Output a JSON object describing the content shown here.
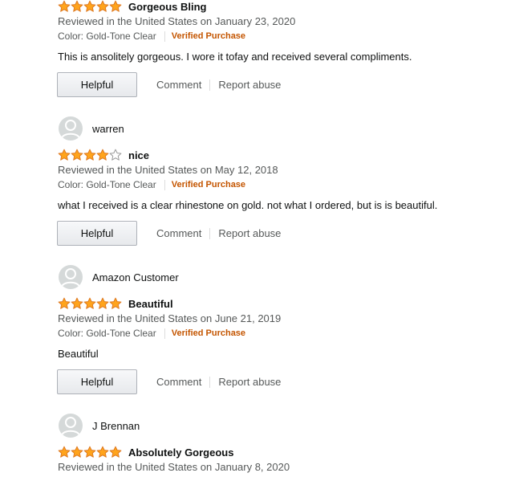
{
  "colors": {
    "star_fill": "#ffa41c",
    "star_stroke": "#de7921",
    "verified": "#c45500"
  },
  "reviews": [
    {
      "name": "",
      "rating": 5,
      "title": "Gorgeous Bling",
      "date": "Reviewed in the United States on January 23, 2020",
      "color": "Color: Gold-Tone Clear",
      "verified": "Verified Purchase",
      "body": "This is ansolitely gorgeous. I wore it tofay and received several compliments.",
      "helpful": "Helpful",
      "comment": "Comment",
      "report": "Report abuse"
    },
    {
      "name": "warren",
      "rating": 4,
      "title": "nice",
      "date": "Reviewed in the United States on May 12, 2018",
      "color": "Color: Gold-Tone Clear",
      "verified": "Verified Purchase",
      "body": "what I received is a clear rhinestone on gold. not what I ordered, but is is beautiful.",
      "helpful": "Helpful",
      "comment": "Comment",
      "report": "Report abuse"
    },
    {
      "name": "Amazon Customer",
      "rating": 5,
      "title": "Beautiful",
      "date": "Reviewed in the United States on June 21, 2019",
      "color": "Color: Gold-Tone Clear",
      "verified": "Verified Purchase",
      "body": "Beautiful",
      "helpful": "Helpful",
      "comment": "Comment",
      "report": "Report abuse"
    },
    {
      "name": "J Brennan",
      "rating": 5,
      "title": "Absolutely Gorgeous",
      "date": "Reviewed in the United States on January 8, 2020"
    }
  ]
}
